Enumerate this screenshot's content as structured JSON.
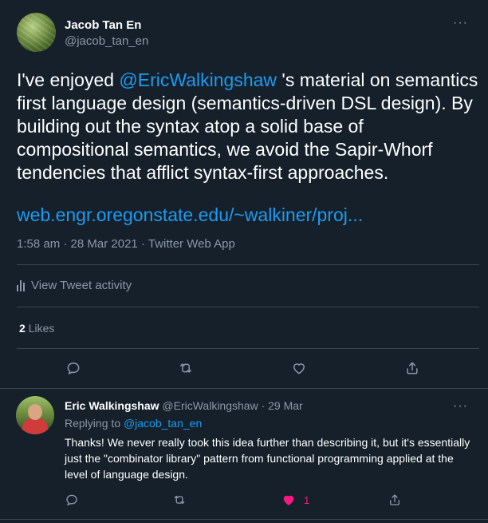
{
  "main_tweet": {
    "author_name": "Jacob Tan En",
    "author_handle": "@jacob_tan_en",
    "text_before_mention": "I've enjoyed ",
    "mention": "@EricWalkingshaw",
    "text_after_mention": " 's material on semantics first language design (semantics-driven DSL design). By building out the syntax atop a solid base of compositional semantics, we avoid the Sapir-Whorf tendencies that afflict syntax-first approaches.",
    "link": "web.engr.oregonstate.edu/~walkiner/proj...",
    "time": "1:58 am",
    "date": "28 Mar 2021",
    "source": "Twitter Web App",
    "activity_label": "View Tweet activity",
    "likes_count": "2",
    "likes_label": "Likes",
    "more_icon": "···"
  },
  "reply": {
    "author_name": "Eric Walkingshaw",
    "author_handle": "@EricWalkingshaw",
    "date": "29 Mar",
    "replying_prefix": "Replying to ",
    "replying_to": "@jacob_tan_en",
    "text": "Thanks! We never really took this idea further than describing it, but it's essentially just the \"combinator library\" pattern from functional programming applied at the level of language design.",
    "like_count": "1",
    "more_icon": "···"
  },
  "colors": {
    "background": "#15202b",
    "accent": "#1d9bf0",
    "muted": "#8b98a5",
    "like": "#f91880",
    "border": "#38444d"
  },
  "icons": [
    "reply-icon",
    "retweet-icon",
    "like-icon",
    "share-icon",
    "bar-chart-icon",
    "more-icon"
  ]
}
